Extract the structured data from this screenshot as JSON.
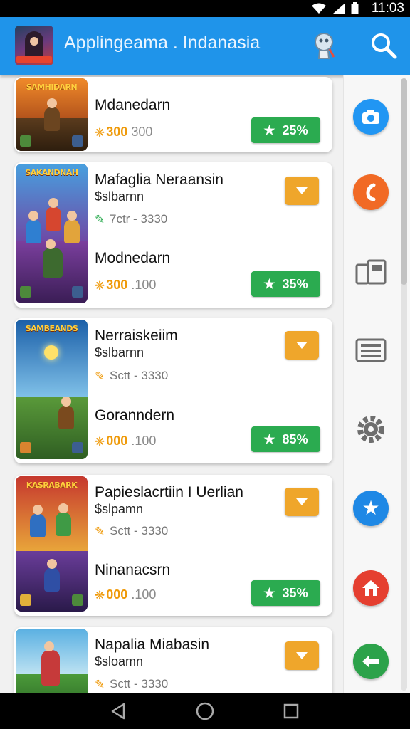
{
  "status_bar": {
    "time": "11:03"
  },
  "app_bar": {
    "title": "Applingeama . Indanasia"
  },
  "cards": [
    {
      "title": "Mdanedarn",
      "price_value": "300",
      "price_alt": "300",
      "discount": "25%"
    },
    {
      "title": "Mafaglia Neraansin",
      "subtitle": "$slbarnn",
      "meta": "7ctr - 3330",
      "title2": "Modnedarn",
      "price_value": "300",
      "price_alt": ".100",
      "discount": "35%"
    },
    {
      "title": "Nerraiskeiim",
      "subtitle": "$slbarnn",
      "meta": "Sctt - 3330",
      "title2": "Goranndern",
      "price_value": "000",
      "price_alt": ".100",
      "discount": "85%"
    },
    {
      "title": "Papieslacrtiin I Uerlian",
      "subtitle": "$slpamn",
      "meta": "Sctt - 3330",
      "title2": "Ninanacsrn",
      "price_value": "000",
      "price_alt": ".100",
      "discount": "35%"
    },
    {
      "title": "Napalia Miabasin",
      "subtitle": "$sloamn",
      "meta": "Sctt - 3330"
    }
  ],
  "thumb_banners": [
    "SAMHIDARN",
    "SAKANDNAH",
    "SAMBEANDS",
    "KASRABARK",
    ""
  ],
  "colors": {
    "accent": "#1f94ea",
    "green": "#2bab50",
    "orange": "#efa62b",
    "price": "#ef9a0a"
  },
  "rail_icons": [
    "camera-icon",
    "phone-icon",
    "gallery-icon",
    "newspaper-icon",
    "gear-icon",
    "star-icon",
    "home-icon",
    "back-arrow-icon"
  ]
}
